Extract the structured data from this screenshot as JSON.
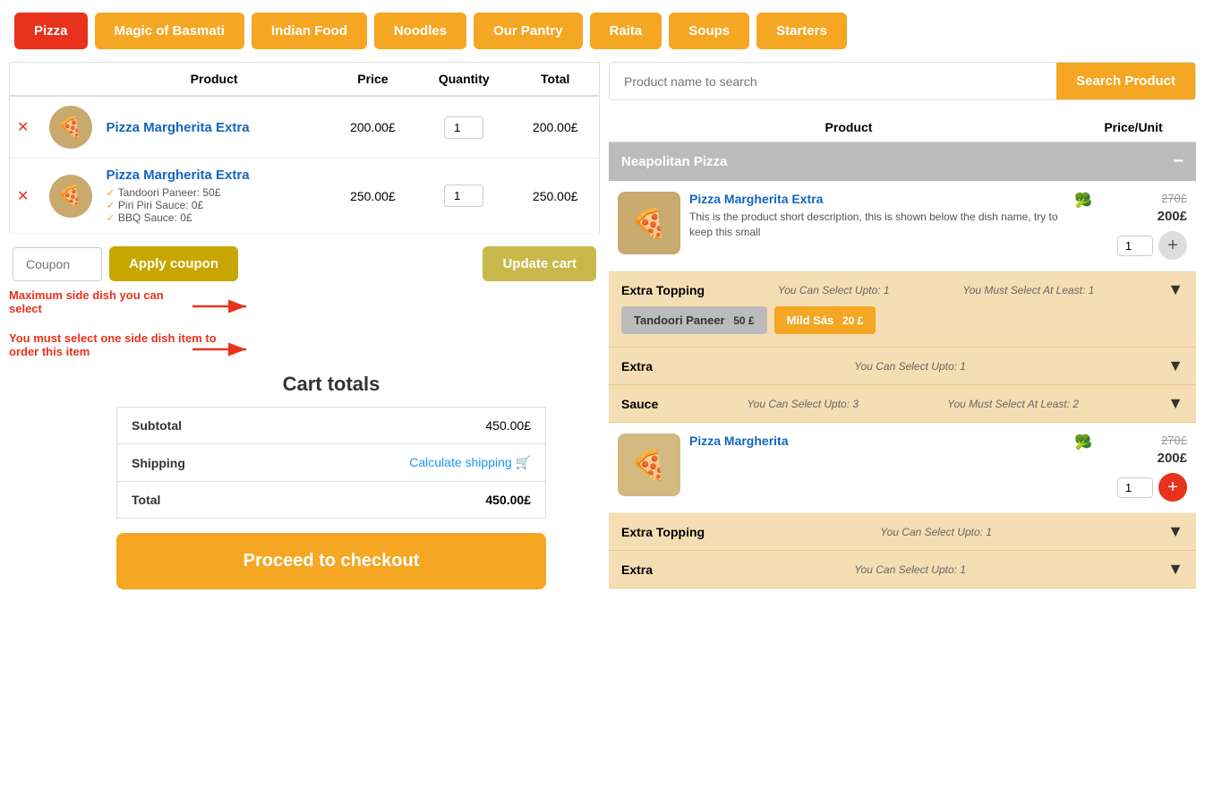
{
  "nav": {
    "items": [
      {
        "label": "Pizza",
        "active": true
      },
      {
        "label": "Magic of Basmati",
        "active": false
      },
      {
        "label": "Indian Food",
        "active": false
      },
      {
        "label": "Noodles",
        "active": false
      },
      {
        "label": "Our Pantry",
        "active": false
      },
      {
        "label": "Raita",
        "active": false
      },
      {
        "label": "Soups",
        "active": false
      },
      {
        "label": "Starters",
        "active": false
      }
    ]
  },
  "cart": {
    "headers": {
      "product": "Product",
      "price": "Price",
      "quantity": "Quantity",
      "total": "Total"
    },
    "items": [
      {
        "id": 1,
        "name": "Pizza Margherita Extra",
        "extras": [],
        "price": "200.00£",
        "qty": 1,
        "total": "200.00£"
      },
      {
        "id": 2,
        "name": "Pizza Margherita Extra",
        "extras": [
          "Tandoori Paneer: 50£",
          "Piri Piri Sauce: 0£",
          "BBQ Sauce: 0£"
        ],
        "price": "250.00£",
        "qty": 1,
        "total": "250.00£"
      }
    ],
    "coupon_placeholder": "Coupon",
    "apply_coupon_label": "Apply coupon",
    "update_cart_label": "Update cart",
    "warning1": "Maximum side dish you can select",
    "warning2": "You must select one side dish item to order this item",
    "totals": {
      "title": "Cart totals",
      "subtotal_label": "Subtotal",
      "subtotal_value": "450.00£",
      "shipping_label": "Shipping",
      "shipping_link": "Calculate shipping",
      "total_label": "Total",
      "total_value": "450.00£"
    },
    "checkout_label": "Proceed to checkout"
  },
  "search": {
    "placeholder": "Product name to search",
    "button_label": "Search Product"
  },
  "product_panel": {
    "headers": {
      "product": "Product",
      "price_unit": "Price/Unit"
    },
    "category": "Neapolitan Pizza",
    "products": [
      {
        "name": "Pizza Margherita Extra",
        "description": "This is the product short description, this is shown below the dish name, try to keep this small",
        "price_original": "270£",
        "price_current": "200£",
        "qty": 1,
        "add_active": false
      },
      {
        "name": "Pizza Margherita",
        "description": "",
        "price_original": "270£",
        "price_current": "200£",
        "qty": 1,
        "add_active": true
      }
    ],
    "toppings": [
      {
        "title": "Extra Topping",
        "select_upto": "You Can Select Upto: 1",
        "must_select": "You Must Select At Least: 1",
        "items": [
          {
            "label": "Tandoori Paneer",
            "price": "50 £",
            "selected": false
          },
          {
            "label": "Mild Sás",
            "price": "20 £",
            "selected": true
          }
        ]
      }
    ],
    "extra_sections": [
      {
        "title": "Extra",
        "select_upto": "You Can Select Upto: 1",
        "must_select": ""
      },
      {
        "title": "Sauce",
        "select_upto": "You Can Select Upto: 3",
        "must_select": "You Must Select At Least: 2"
      }
    ],
    "product2_toppings": [
      {
        "title": "Extra Topping",
        "select_upto": "You Can Select Upto: 1",
        "must_select": ""
      },
      {
        "title": "Extra",
        "select_upto": "You Can Select Upto: 1",
        "must_select": ""
      }
    ]
  }
}
